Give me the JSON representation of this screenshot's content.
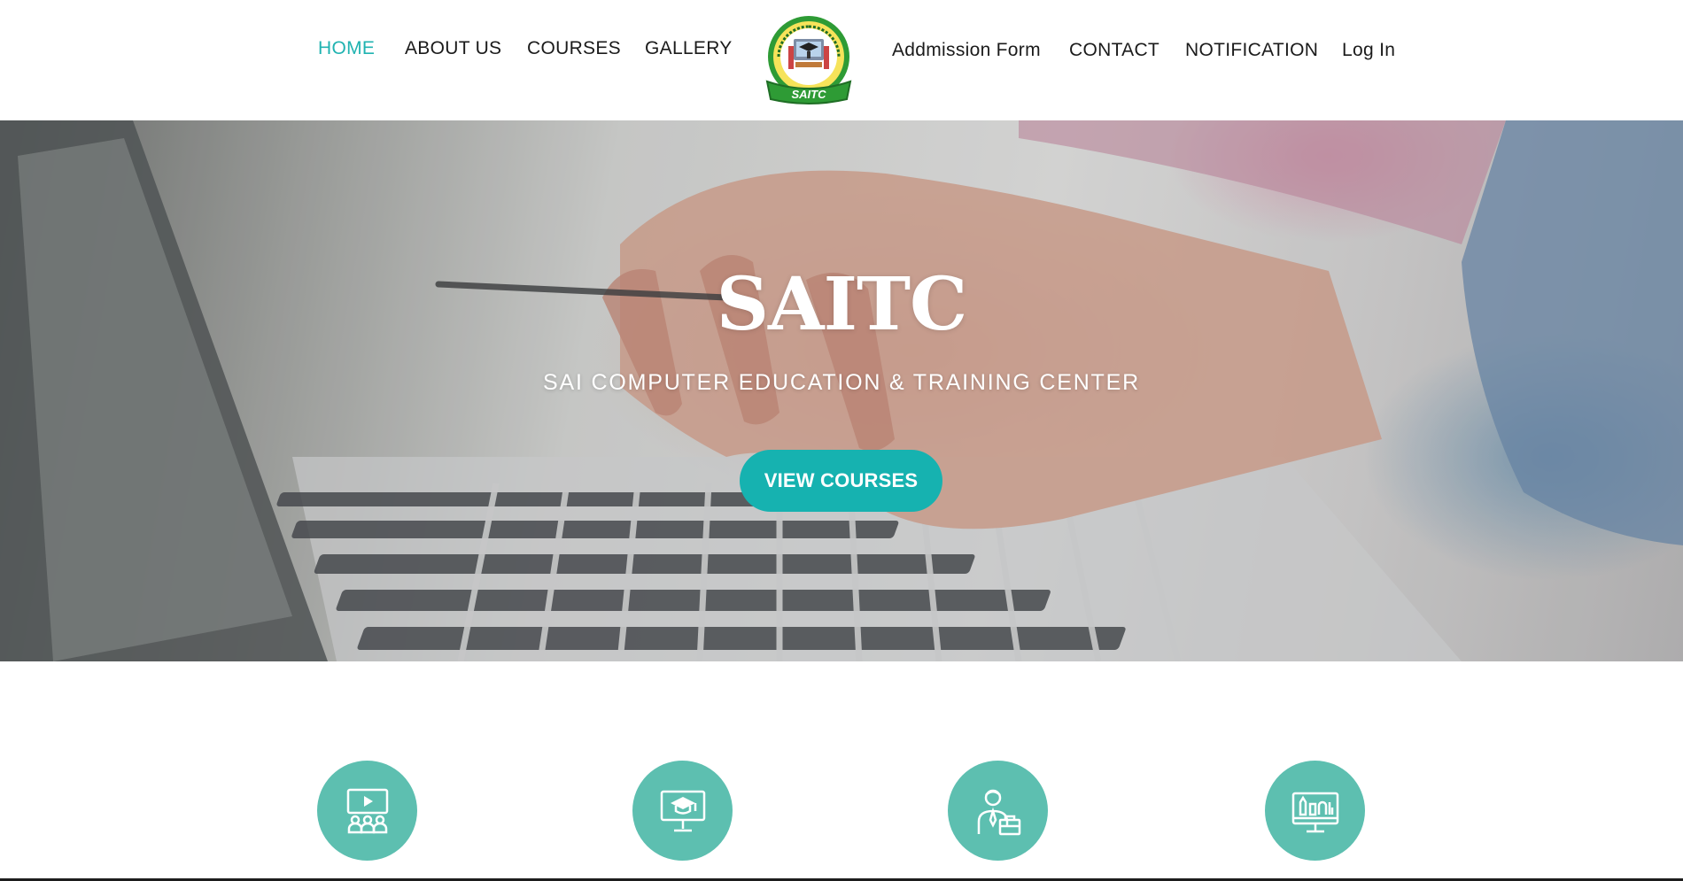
{
  "nav": {
    "left_items": [
      {
        "label": "HOME",
        "active": true
      },
      {
        "label": "ABOUT US",
        "active": false
      },
      {
        "label": "COURSES",
        "active": false
      },
      {
        "label": "GALLERY",
        "active": false
      }
    ],
    "right_items": [
      {
        "label": "Addmission Form"
      },
      {
        "label": "CONTACT"
      },
      {
        "label": "NOTIFICATION"
      },
      {
        "label": "Log In"
      }
    ],
    "logo": {
      "ring_text": "SAI COMPUTER EDUCATION & TRAINING CENTER",
      "banner_text": "SAITC"
    }
  },
  "hero": {
    "title": "SAITC",
    "subtitle": "SAI COMPUTER EDUCATION & TRAINING CENTER",
    "button_label": "VIEW COURSES"
  },
  "features": [
    {
      "icon": "video-class-icon"
    },
    {
      "icon": "online-graduation-icon"
    },
    {
      "icon": "professional-instructor-icon"
    },
    {
      "icon": "computer-design-icon"
    }
  ],
  "colors": {
    "accent": "#16b2b0",
    "nav_active": "#20b3b1",
    "feature_circle": "#5dbfb0",
    "logo_green": "#2e9b35"
  }
}
